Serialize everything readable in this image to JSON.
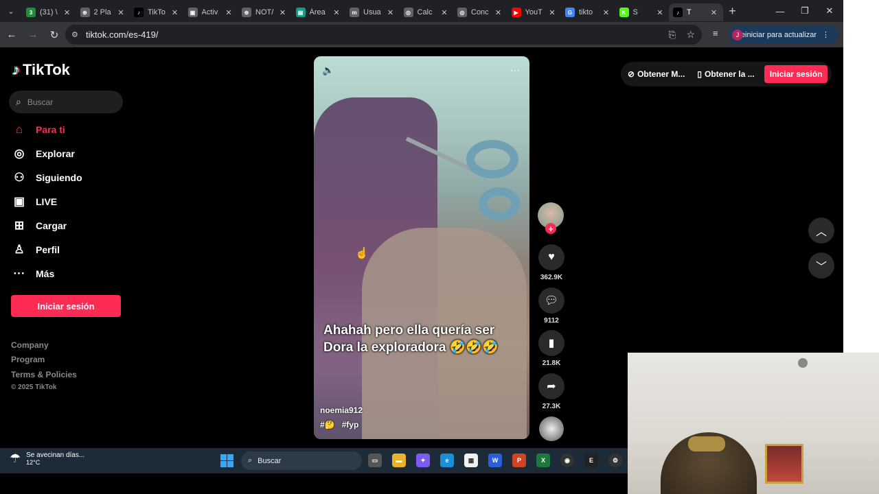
{
  "browser": {
    "tabs": [
      {
        "title": "(31) \\",
        "color": "#1e8e3e",
        "icon": "3"
      },
      {
        "title": "2 Pla",
        "color": "#5f6368",
        "icon": "⊕"
      },
      {
        "title": "TikTo",
        "color": "#000000",
        "icon": "♪"
      },
      {
        "title": "Activ",
        "color": "#5f6368",
        "icon": "▣"
      },
      {
        "title": "NOT/",
        "color": "#5f6368",
        "icon": "⊕"
      },
      {
        "title": "Área",
        "color": "#0f9d8a",
        "icon": "▤"
      },
      {
        "title": "Usua",
        "color": "#5f6368",
        "icon": "m"
      },
      {
        "title": "Calc",
        "color": "#5f6368",
        "icon": "◎"
      },
      {
        "title": "Conc",
        "color": "#5f6368",
        "icon": "◎"
      },
      {
        "title": "YouT",
        "color": "#ff0000",
        "icon": "▶"
      },
      {
        "title": "tikto",
        "color": "#4285f4",
        "icon": "G"
      },
      {
        "title": "S",
        "color": "#53fc18",
        "icon": "K"
      },
      {
        "title": "T",
        "color": "#000000",
        "icon": "♪",
        "active": true
      }
    ],
    "url": "tiktok.com/es-419/",
    "update_button": "Reiniciar para actualizar",
    "profile_initial": "J"
  },
  "sidebar": {
    "logo_text": "TikTok",
    "search_placeholder": "Buscar",
    "nav": [
      {
        "label": "Para ti",
        "icon": "home-icon",
        "active": true
      },
      {
        "label": "Explorar",
        "icon": "compass-icon"
      },
      {
        "label": "Siguiendo",
        "icon": "following-icon"
      },
      {
        "label": "LIVE",
        "icon": "live-icon"
      },
      {
        "label": "Cargar",
        "icon": "upload-icon"
      },
      {
        "label": "Perfil",
        "icon": "profile-icon"
      },
      {
        "label": "Más",
        "icon": "more-icon"
      }
    ],
    "login_button": "Iniciar sesión",
    "footer": [
      "Company",
      "Program",
      "Terms & Policies"
    ],
    "copyright": "© 2025 TikTok"
  },
  "video": {
    "caption": "Ahahah pero ella quería ser Dora la exploradora 🤣🤣🤣",
    "username": "noemia912",
    "tags": [
      "#🤔",
      "#fyp"
    ]
  },
  "actions": {
    "likes": "362.9K",
    "comments": "9112",
    "saves": "21.8K",
    "shares": "27.3K"
  },
  "top_right": {
    "get_app_1": "Obtener M...",
    "get_app_2": "Obtener la ...",
    "login": "Iniciar sesión"
  },
  "taskbar": {
    "weather_title": "Se avecinan días...",
    "weather_temp": "12°C",
    "search": "Buscar"
  },
  "colors": {
    "accent": "#fe2c55",
    "background": "#000000"
  }
}
